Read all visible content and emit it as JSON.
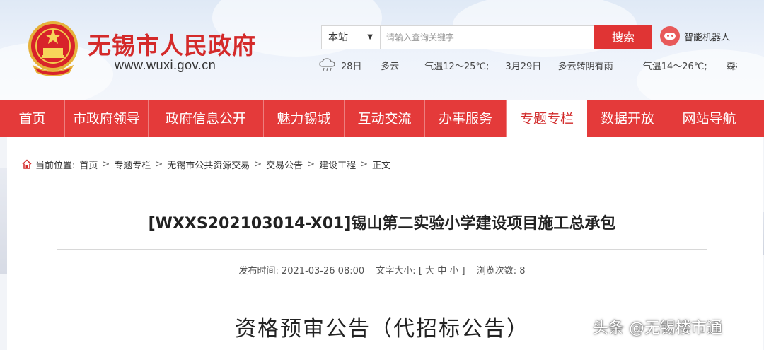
{
  "header": {
    "site_name": "无锡市人民政府",
    "site_url": "www.wuxi.gov.cn",
    "search": {
      "scope": "本站",
      "placeholder": "请输入查询关键字",
      "button": "搜索"
    },
    "robot_label": "智能机器人",
    "weather": {
      "icon": "cloud-rain-icon",
      "items": [
        "28日",
        "多云",
        "气温12～25℃;",
        "3月29日",
        "多云转阴有雨",
        "气温14～26℃;",
        "森林火"
      ]
    }
  },
  "nav": {
    "items": [
      {
        "label": "首页"
      },
      {
        "label": "市政府领导"
      },
      {
        "label": "政府信息公开"
      },
      {
        "label": "魅力锡城"
      },
      {
        "label": "互动交流"
      },
      {
        "label": "办事服务"
      },
      {
        "label": "专题专栏",
        "active": true
      },
      {
        "label": "数据开放"
      },
      {
        "label": "网站导航"
      }
    ]
  },
  "breadcrumb": {
    "prefix": "当前位置:",
    "items": [
      "首页",
      "专题专栏",
      "无锡市公共资源交易",
      "交易公告",
      "建设工程",
      "正文"
    ],
    "separator": ">"
  },
  "article": {
    "title": "[WXXS202103014-X01]锡山第二实验小学建设项目施工总承包",
    "meta": {
      "published_label": "发布时间:",
      "published": "2021-03-26 08:00",
      "fontsize_label": "文字大小:",
      "fontsize_open": "[",
      "fontsize_large": "大",
      "fontsize_medium": "中",
      "fontsize_small": "小",
      "fontsize_close": "]",
      "views_label": "浏览次数:",
      "views": "8"
    },
    "heading": "资格预审公告（代招标公告）"
  },
  "watermark": "头条 @无锡楼市通",
  "colors": {
    "brand_red": "#e43a3a",
    "title_red": "#d42a2a"
  }
}
